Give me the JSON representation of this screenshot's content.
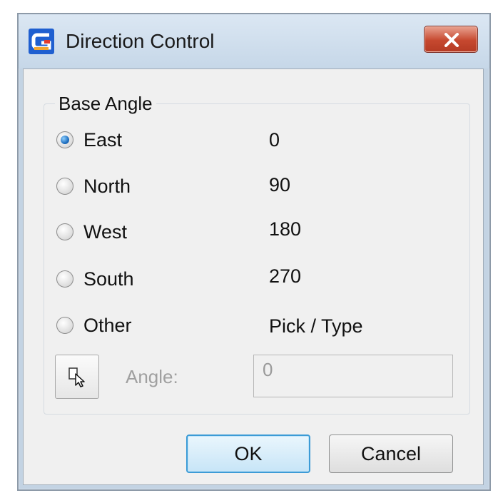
{
  "window": {
    "title": "Direction Control",
    "app_icon": "gstarcad-logo-icon",
    "close_icon": "close-icon"
  },
  "base_angle": {
    "group_label": "Base Angle",
    "options": [
      {
        "label": "East",
        "value": "0",
        "checked": true
      },
      {
        "label": "North",
        "value": "90",
        "checked": false
      },
      {
        "label": "West",
        "value": "180",
        "checked": false
      },
      {
        "label": "South",
        "value": "270",
        "checked": false
      },
      {
        "label": "Other",
        "value": "Pick / Type",
        "checked": false
      }
    ],
    "pick_icon": "pick-point-cursor-icon",
    "angle_label": "Angle:",
    "angle_value": "0"
  },
  "buttons": {
    "ok_label": "OK",
    "cancel_label": "Cancel"
  },
  "colors": {
    "selected_radio": "#1f6fc0",
    "close_button": "#c6482f",
    "default_button_border": "#3c9bd6",
    "disabled_text": "#a0a0a0"
  }
}
